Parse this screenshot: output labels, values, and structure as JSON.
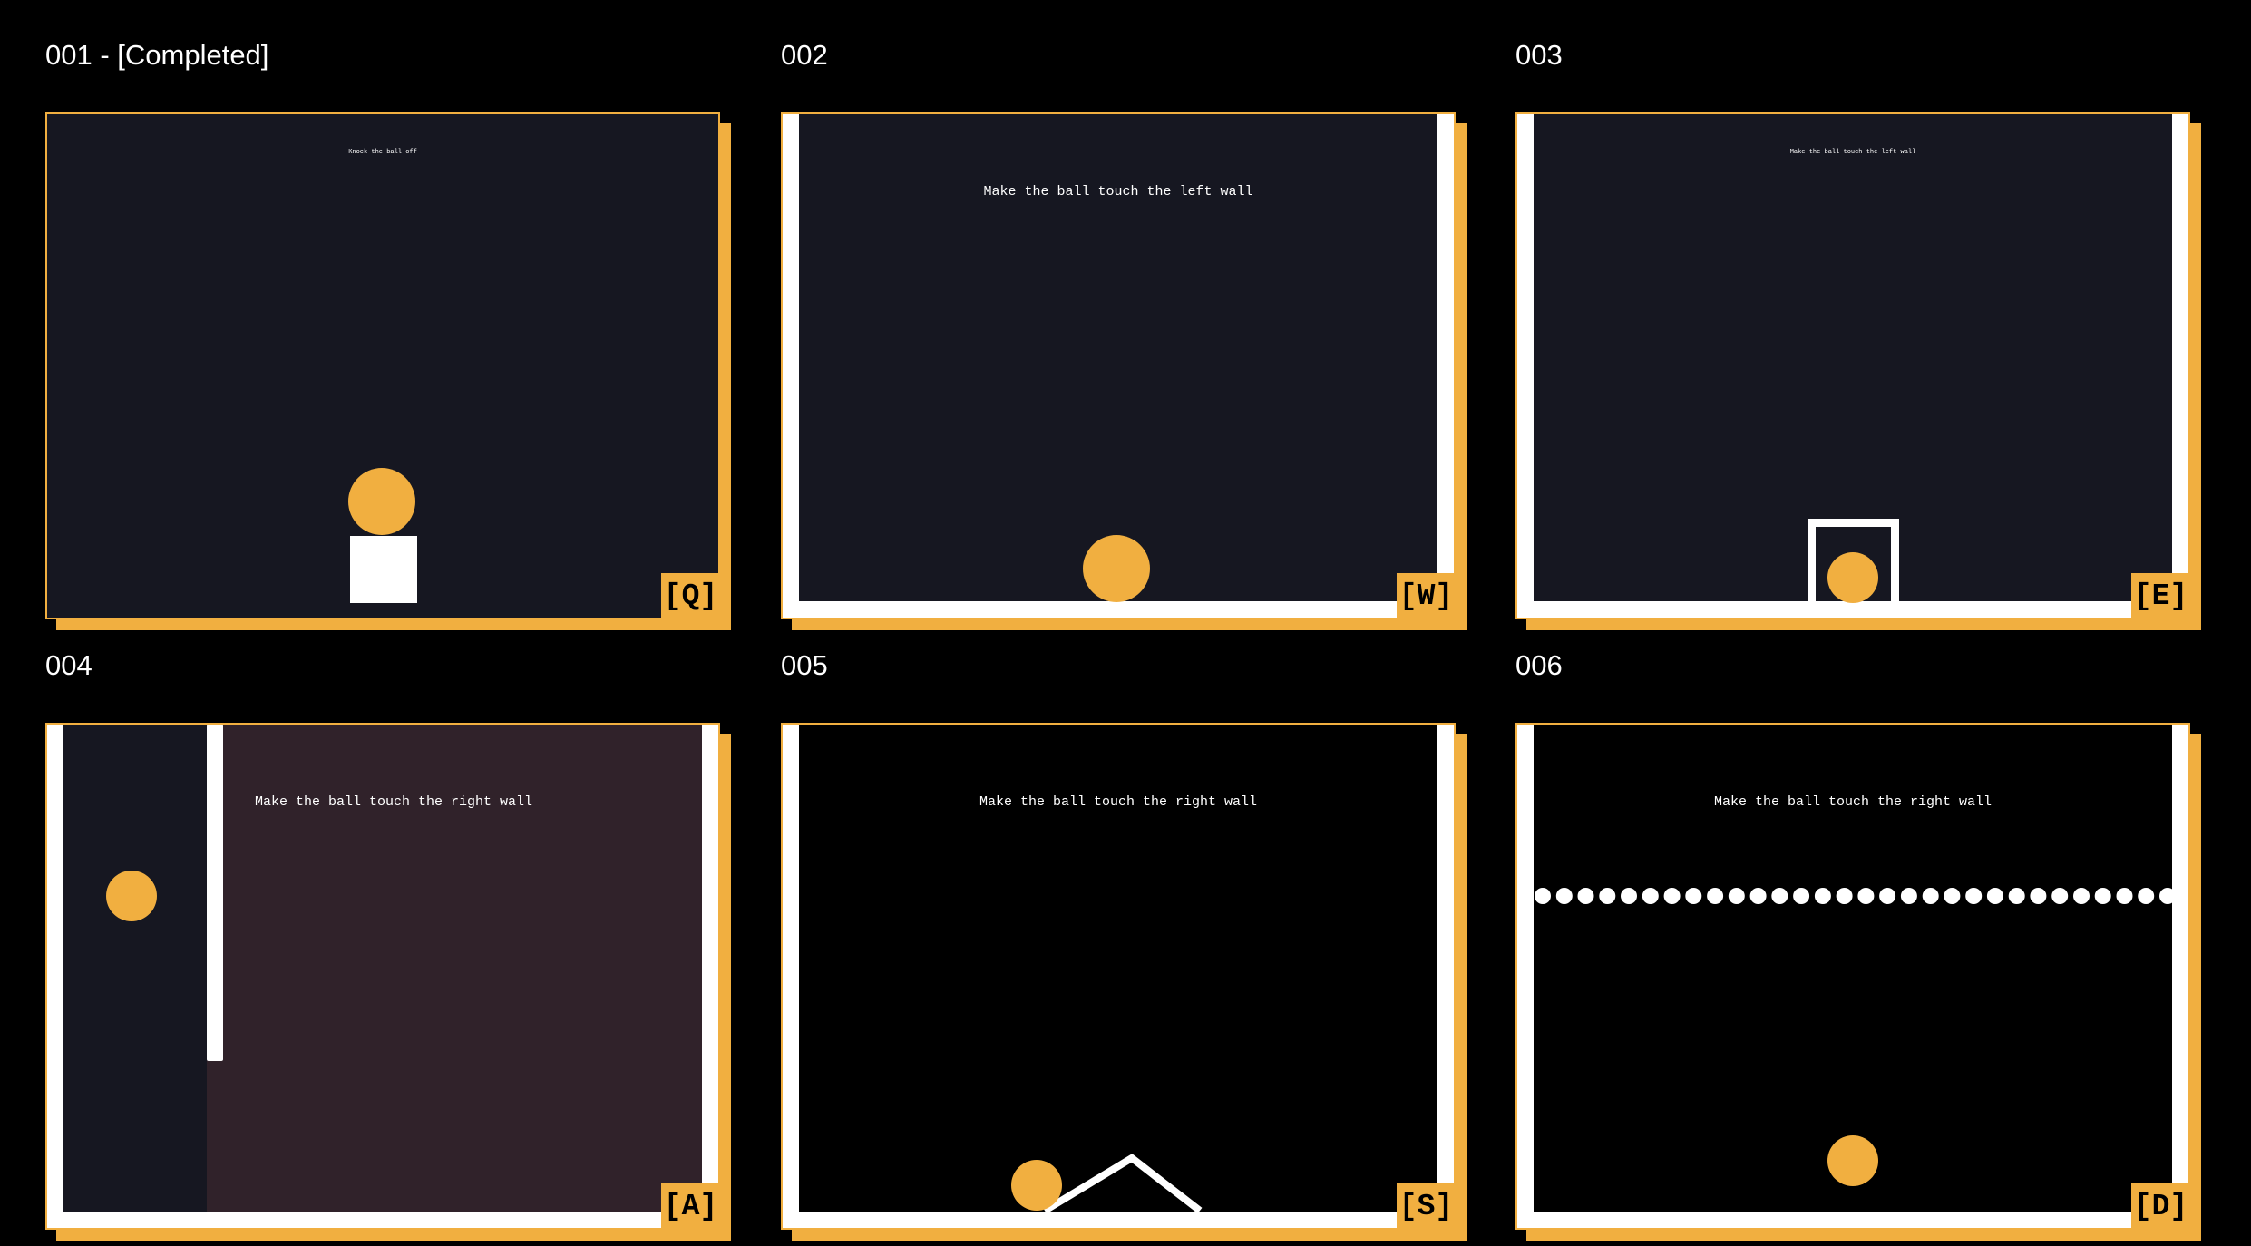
{
  "colors": {
    "accent": "#f1af40",
    "page_background": "#000000",
    "scene_dark": "#161721",
    "scene_black": "#000000",
    "scene_maroon": "#30222a",
    "wall": "#ffffff"
  },
  "levels": [
    {
      "title": "001 - [Completed]",
      "goal": "Knock the ball off",
      "key": "[Q]"
    },
    {
      "title": "002",
      "goal": "Make the ball touch the left wall",
      "key": "[W]"
    },
    {
      "title": "003",
      "goal": "Make the ball touch the left wall",
      "key": "[E]"
    },
    {
      "title": "004",
      "goal": "Make the ball touch the right wall",
      "key": "[A]"
    },
    {
      "title": "005",
      "goal": "Make the ball touch the right wall",
      "key": "[S]"
    },
    {
      "title": "006",
      "goal": "Make the ball touch the right wall",
      "key": "[D]"
    }
  ]
}
